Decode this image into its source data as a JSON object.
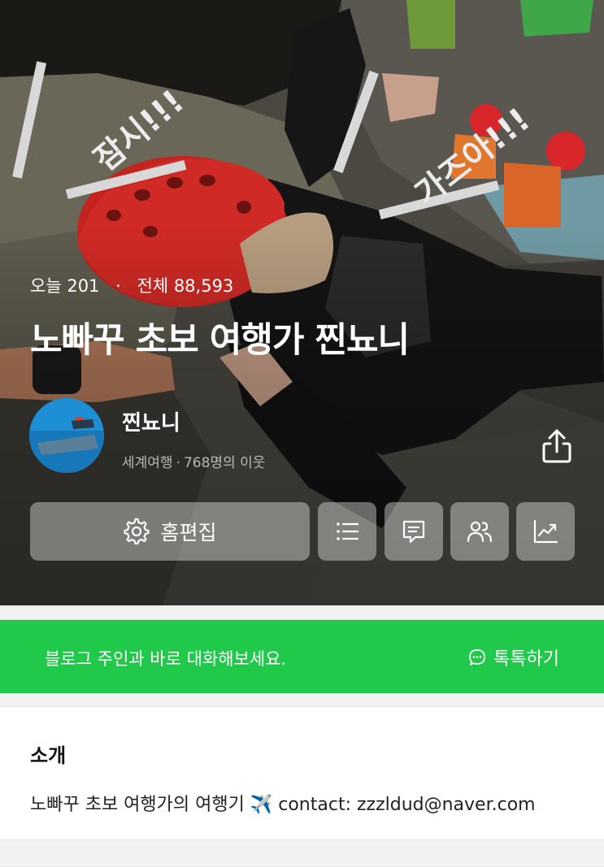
{
  "hero": {
    "overlay_text": [
      "잠시!!!",
      "가즈아!!!"
    ],
    "stats": {
      "today_label": "오늘",
      "today_value": "201",
      "dot": "·",
      "total_label": "전체",
      "total_value": "88,593"
    },
    "blog_title": "노빠꾸 초보 여행가 찐뇨니",
    "owner": {
      "name": "찐뇨니",
      "category": "세계여행",
      "separator": "·",
      "neighbors": "768명의 이웃"
    },
    "buttons": {
      "edit_label": "홈편집",
      "icons": [
        "gear-icon",
        "share-icon",
        "list-icon",
        "comment-icon",
        "people-icon",
        "stats-chart-icon"
      ]
    }
  },
  "talk": {
    "message": "블로그 주인과 바로 대화해보세요.",
    "cta": "톡톡하기",
    "color": "#21c94b"
  },
  "intro": {
    "heading": "소개",
    "text": "노빠꾸 초보 여행가의 여행기 ✈️ contact: zzzldud@naver.com"
  }
}
